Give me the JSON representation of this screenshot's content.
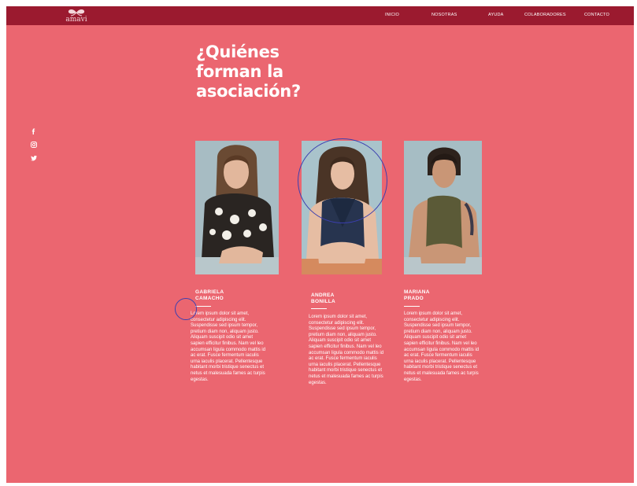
{
  "brand": {
    "name": "amavi"
  },
  "nav": {
    "items": [
      {
        "label": "INICIO"
      },
      {
        "label": "NOSOTRAS"
      },
      {
        "label": "AYUDA"
      },
      {
        "label": "COLABORADORES"
      },
      {
        "label": "CONTACTO"
      }
    ]
  },
  "main": {
    "title_line1": "¿Quiénes",
    "title_line2": "forman la",
    "title_line3": "asociación?"
  },
  "social": {
    "icons": [
      "facebook-icon",
      "instagram-icon",
      "twitter-icon"
    ]
  },
  "members": [
    {
      "first": "GABRIELA",
      "last": "CAMACHO",
      "bio": "Lorem ipsum dolor sit amet, consectetur adipiscing elit. Suspendisse sed ipsum tempor, pretium diam non, aliquam justo. Aliquam suscipit odio sit amet sapien efficitur finibus. Nam vel leo accumsan ligula commodo mattis id ac erat. Fusce fermentum iaculis urna iaculis placerat. Pellentesque habitant morbi tristique senectus et netus et malesuada fames ac turpis egestas."
    },
    {
      "first": "ANDREA",
      "last": "BONILLA",
      "bio": "Lorem ipsum dolor sit amet, consectetur adipiscing elit. Suspendisse sed ipsum tempor, pretium diam non, aliquam justo. Aliquam suscipit odio sit amet sapien efficitur finibus. Nam vel leo accumsan ligula commodo mattis id ac erat. Fusce fermentum iaculis urna iaculis placerat. Pellentesque habitant morbi tristique senectus et netus et malesuada fames ac turpis egestas."
    },
    {
      "first": "MARIANA",
      "last": "PRADO",
      "bio": "Lorem ipsum dolor sit amet, consectetur adipiscing elit. Suspendisse sed ipsum tempor, pretium diam non, aliquam justo. Aliquam suscipit odio sit amet sapien efficitur finibus. Nam vel leo accumsan ligula commodo mattis id ac erat. Fusce fermentum iaculis urna iaculis placerat. Pellentesque habitant morbi tristique senectus et netus et malesuada fames ac turpis egestas."
    }
  ],
  "colors": {
    "background": "#eb6670",
    "header": "#9b1a2f",
    "text": "#ffffff",
    "annotation": "#3b3fb0"
  }
}
